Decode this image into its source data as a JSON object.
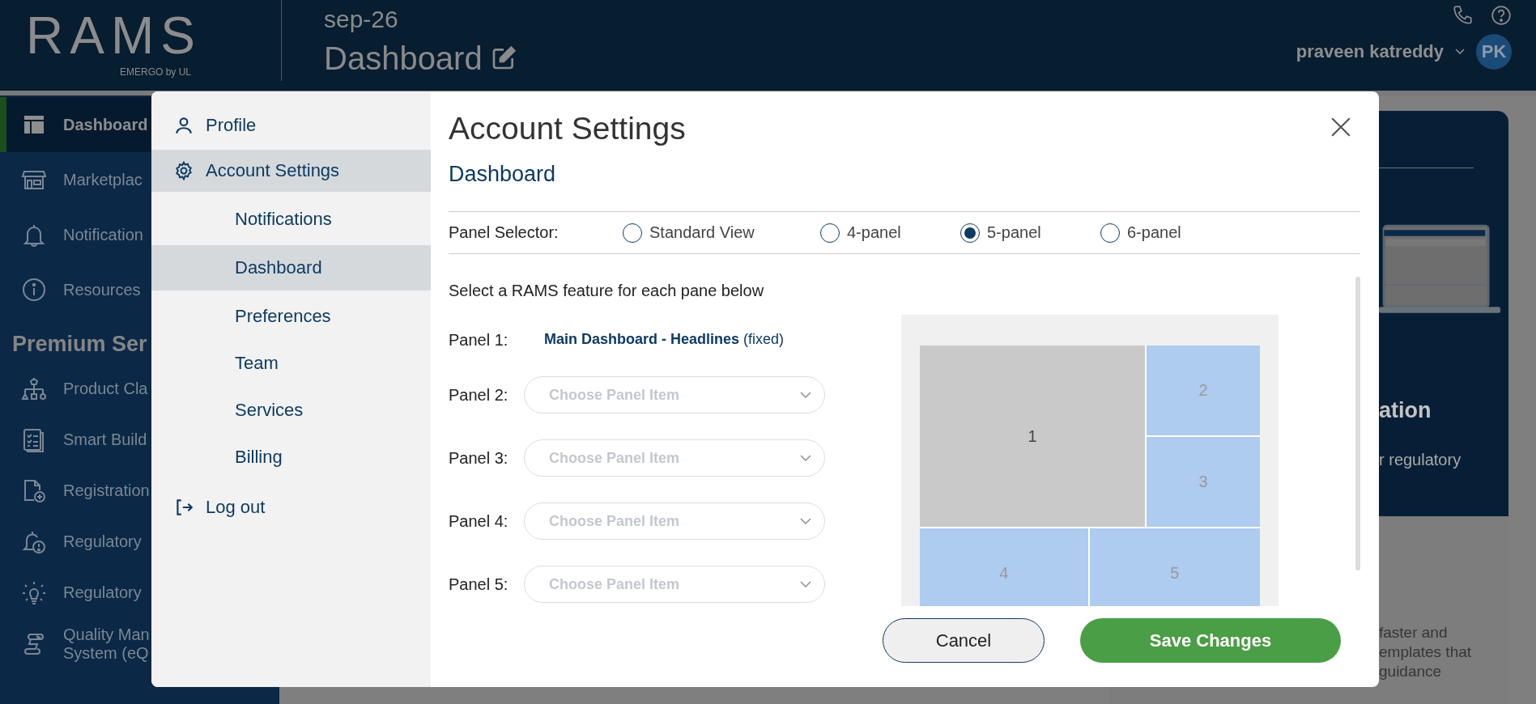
{
  "header": {
    "logo": "RAMS",
    "logo_tagline": "EMERGO by UL",
    "project": "sep-26",
    "page_title": "Dashboard",
    "user_name": "praveen katreddy",
    "avatar_initials": "PK"
  },
  "sidebar": {
    "items": [
      {
        "label": "Dashboard",
        "kind": "layout",
        "selected": true
      },
      {
        "label": "Marketplac",
        "kind": "store",
        "selected": false
      },
      {
        "label": "Notification",
        "kind": "bell",
        "selected": false
      },
      {
        "label": "Resources",
        "kind": "info",
        "selected": false
      }
    ],
    "section_title": "Premium Ser",
    "premium_items": [
      {
        "label": "Product Cla",
        "kind": "hierarchy"
      },
      {
        "label": "Smart Build",
        "kind": "checklist"
      },
      {
        "label": "Registration",
        "kind": "doc-plus"
      },
      {
        "label": "Regulatory",
        "kind": "bell-alert"
      },
      {
        "label": "Regulatory",
        "kind": "bulb"
      },
      {
        "label": "Quality Man",
        "label_line2": "System (eQ",
        "kind": "scroll"
      }
    ]
  },
  "background_card": {
    "heading": "ation",
    "text": "r regulatory"
  },
  "background_panel": {
    "lines": [
      "faster and",
      "emplates that",
      "guidance"
    ]
  },
  "modal": {
    "nav": [
      {
        "label": "Profile",
        "kind": "person",
        "selected": false
      },
      {
        "label": "Account Settings",
        "kind": "gear",
        "selected": true,
        "children": [
          {
            "label": "Notifications",
            "selected": false
          },
          {
            "label": "Dashboard",
            "selected": true
          },
          {
            "label": "Preferences",
            "selected": false
          },
          {
            "label": "Team",
            "selected": false
          },
          {
            "label": "Services",
            "selected": false
          },
          {
            "label": "Billing",
            "selected": false
          }
        ]
      }
    ],
    "logout": "Log out",
    "title": "Account Settings",
    "section_title": "Dashboard",
    "panel_selector": {
      "label": "Panel Selector:",
      "options": [
        {
          "label": "Standard View",
          "selected": false
        },
        {
          "label": "4-panel",
          "selected": false
        },
        {
          "label": "5-panel",
          "selected": true
        },
        {
          "label": "6-panel",
          "selected": false
        }
      ]
    },
    "instructions": "Select a RAMS feature for each pane below",
    "panels": [
      {
        "label": "Panel 1:",
        "kind": "fixed",
        "value": "**Main Dashboard - Headlines** (fixed)"
      },
      {
        "label": "Panel 2:",
        "kind": "select",
        "placeholder": "Choose Panel Item"
      },
      {
        "label": "Panel 3:",
        "kind": "select",
        "placeholder": "Choose Panel Item"
      },
      {
        "label": "Panel 4:",
        "kind": "select",
        "placeholder": "Choose Panel Item"
      },
      {
        "label": "Panel 5:",
        "kind": "select",
        "placeholder": "Choose Panel Item"
      }
    ],
    "preview": {
      "cells": [
        {
          "label": "1",
          "fixed": true
        },
        {
          "label": "2",
          "fixed": false
        },
        {
          "label": "3",
          "fixed": false
        },
        {
          "label": "4",
          "fixed": false
        },
        {
          "label": "5",
          "fixed": false
        }
      ]
    },
    "buttons": {
      "cancel": "Cancel",
      "save": "Save Changes"
    }
  }
}
